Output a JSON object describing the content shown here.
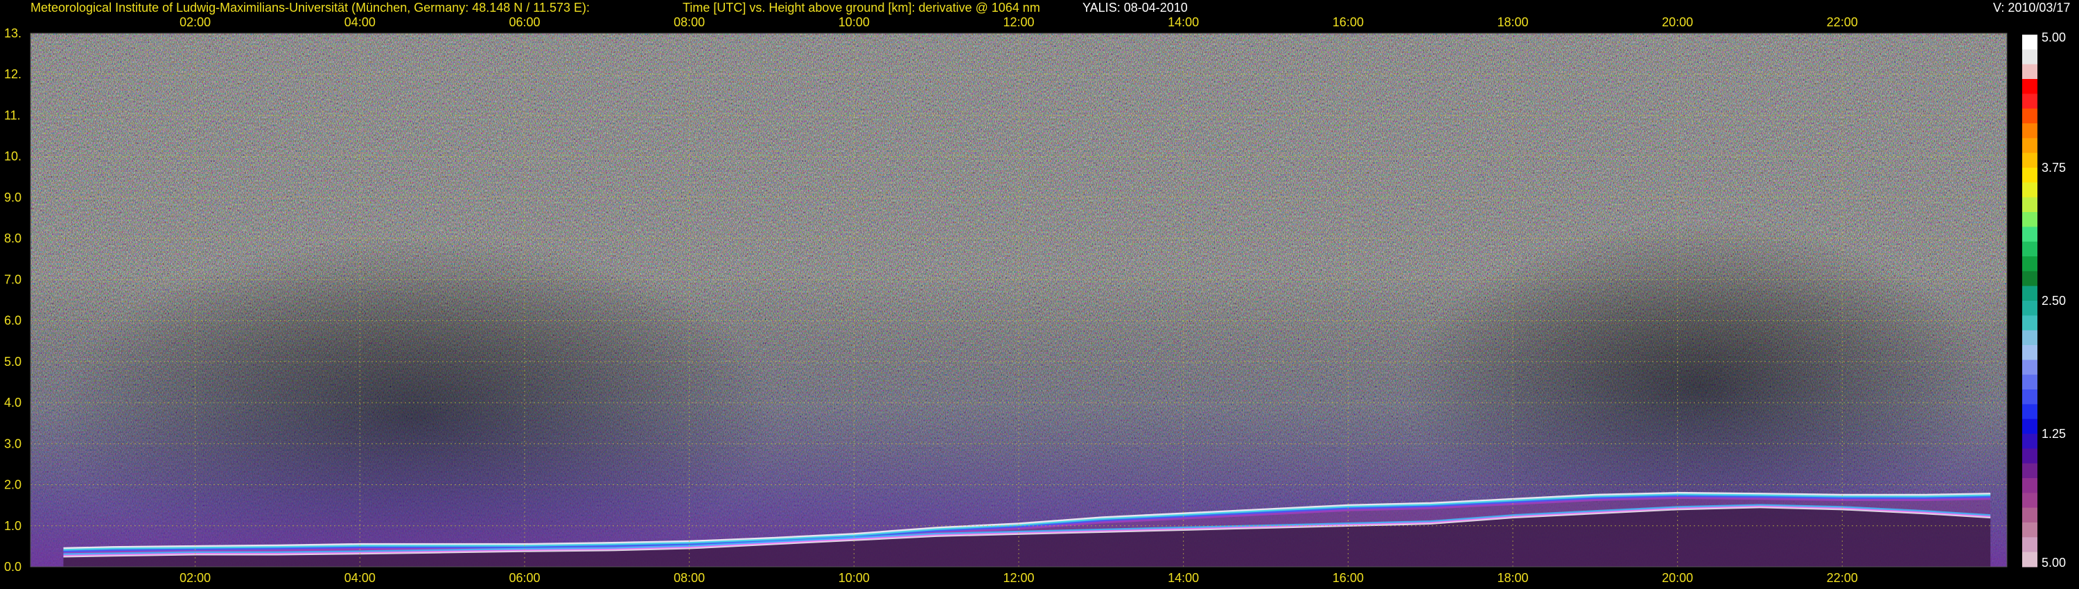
{
  "header": {
    "institute": "Meteorological Institute of Ludwig-Maximilians-Universität (München, Germany: 48.148 N / 11.573 E):",
    "description": "Time [UTC] vs. Height above ground [km]: derivative @ 1064 nm",
    "instrument_date": "YALIS: 08-04-2010",
    "version": "V: 2010/03/17"
  },
  "colors": {
    "header_text": "#f0e020",
    "grid": "#c8c040",
    "axis_text": "#f0e020"
  },
  "chart_data": {
    "type": "heatmap",
    "xlabel": "Time [UTC]",
    "ylabel": "Height above ground [km]",
    "xlim_hours": [
      0,
      24
    ],
    "ylim": [
      0,
      13
    ],
    "x_ticks": [
      "02:00",
      "04:00",
      "06:00",
      "08:00",
      "10:00",
      "12:00",
      "14:00",
      "16:00",
      "18:00",
      "20:00",
      "22:00"
    ],
    "y_ticks": [
      "0.0",
      "1.0",
      "2.0",
      "3.0",
      "4.0",
      "5.0",
      "6.0",
      "7.0",
      "8.0",
      "9.0",
      "10.",
      "11.",
      "12.",
      "13."
    ],
    "colorbar": {
      "labels": [
        "5.00",
        "3.75",
        "2.50",
        "1.25",
        "5.00"
      ],
      "colors": [
        "#ffffff",
        "#e8e8e8",
        "#f0c0c0",
        "#ff0000",
        "#ff2020",
        "#ff5000",
        "#ff8000",
        "#ffa000",
        "#ffc000",
        "#ffe000",
        "#e8f020",
        "#c0f040",
        "#80f060",
        "#40e080",
        "#20c060",
        "#10a040",
        "#108030",
        "#10a080",
        "#20b0a0",
        "#40c0c0",
        "#80c0e0",
        "#a0c0f0",
        "#8090f0",
        "#6070f0",
        "#4050f0",
        "#2030f0",
        "#1010e0",
        "#3010c0",
        "#5010a0",
        "#702090",
        "#903090",
        "#a04090",
        "#b06090",
        "#c080a0",
        "#d0a0c0",
        "#e0c0d0"
      ]
    },
    "boundary_layer_top_km": {
      "hours": [
        0.4,
        1,
        2,
        3,
        4,
        5,
        6,
        7,
        8,
        9,
        10,
        11,
        12,
        13,
        14,
        15,
        16,
        17,
        18,
        19,
        20,
        21,
        22,
        23,
        23.8
      ],
      "values": [
        0.45,
        0.48,
        0.5,
        0.52,
        0.55,
        0.55,
        0.55,
        0.58,
        0.62,
        0.7,
        0.8,
        0.95,
        1.05,
        1.2,
        1.3,
        1.4,
        1.5,
        1.55,
        1.65,
        1.75,
        1.8,
        1.78,
        1.75,
        1.75,
        1.78
      ]
    },
    "lower_layer_top_km": {
      "hours": [
        0.4,
        1,
        2,
        3,
        4,
        5,
        6,
        7,
        8,
        9,
        10,
        11,
        12,
        13,
        14,
        15,
        16,
        17,
        18,
        19,
        20,
        21,
        22,
        23,
        23.8
      ],
      "values": [
        0.25,
        0.27,
        0.3,
        0.3,
        0.32,
        0.35,
        0.38,
        0.4,
        0.45,
        0.55,
        0.65,
        0.75,
        0.8,
        0.85,
        0.9,
        0.95,
        1.0,
        1.05,
        1.2,
        1.3,
        1.4,
        1.45,
        1.4,
        1.3,
        1.2
      ]
    }
  }
}
